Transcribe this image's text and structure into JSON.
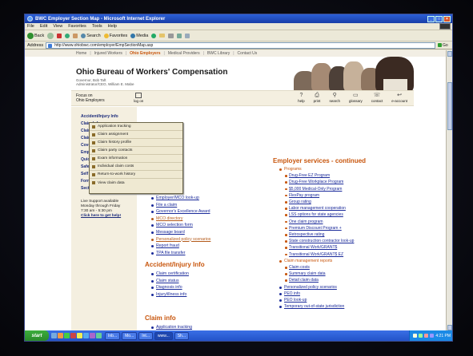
{
  "window": {
    "title": "BWC Employer Section Map - Microsoft Internet Explorer",
    "controls": [
      "_",
      "□",
      "×"
    ]
  },
  "menubar": [
    "File",
    "Edit",
    "View",
    "Favorites",
    "Tools",
    "Help"
  ],
  "toolbar": {
    "back": "Back",
    "search": "Search",
    "favorites": "Favorites",
    "media": "Media"
  },
  "addressbar": {
    "label": "Address",
    "url": "http://www.ohiobwc.com/employer/EmpSectionMap.asp",
    "go": "Go"
  },
  "topnav": [
    "Home",
    "Injured Workers",
    "Ohio Employers",
    "Medical Providers",
    "BWC Library",
    "Contact Us"
  ],
  "banner": {
    "title": "Ohio Bureau of Workers' Compensation",
    "governor": "Governor, Bob Taft",
    "administrator": "Administrator/CEO, William E. Mabe"
  },
  "iconbar": {
    "focus_line1": "Focus on",
    "focus_line2": "Ohio Employers",
    "login": "log on",
    "tools": [
      {
        "label": "help",
        "icon": "?"
      },
      {
        "label": "print",
        "icon": "⎙"
      },
      {
        "label": "search",
        "icon": "⚲"
      },
      {
        "label": "glossary",
        "icon": "▭"
      },
      {
        "label": "contact",
        "icon": "☏"
      },
      {
        "label": "e-account",
        "icon": "↩"
      }
    ]
  },
  "sidebar": {
    "items": [
      "Accident/Injury Info",
      "Claim Info",
      "Claim Payme",
      "Claim Referr",
      "Coverage Inf",
      "Employer Se",
      "Quick Pay",
      "Safety Servi",
      "Self Insured",
      "Forms",
      "Section Map"
    ],
    "support": [
      "Live Support available",
      "Monday through Friday",
      "7:30 am - 5:30 pm"
    ],
    "support_link": "Click here to get help!"
  },
  "popup": [
    "Application tracking",
    "Claim assignment",
    "Claim history profile",
    "Claim party contacts",
    "Exam information",
    "Individual claim costs",
    "Return-to-work history",
    "View claim data"
  ],
  "left_list": [
    "Employer/MCO look-up",
    "File a claim",
    "Governor's Excellence Award",
    "MCO directory",
    "MCO selection form",
    "Message board",
    "Personalized policy scenarios",
    "Report fraud",
    "TPA file transfer"
  ],
  "accident": {
    "heading": "Accident/Injury Info",
    "items": [
      "Claim certification",
      "Claim status",
      "Diagnosis info",
      "Injury/illness info"
    ]
  },
  "claiminfo": {
    "heading": "Claim info",
    "items": [
      "Application tracking"
    ]
  },
  "employer_services": {
    "heading": "Employer services - continued",
    "programs_label": "Programs",
    "programs": [
      "Drug-Free EZ Program",
      "Drug-Free Workplace Program",
      "$5,000 Medical-Only Program",
      "FlexPay program",
      "Group rating",
      "Labor management cooperation",
      "LSS options for state agencies",
      "One claim program",
      "Premium Discount Program +",
      "Retrospective rating",
      "State construction contractor look-up",
      "Transitional Work/GRANT$",
      "Transitional Work/GRANT$ EZ"
    ],
    "claim_reports_label": "Claim management reports",
    "claim_reports": [
      "Claim costs",
      "Summary claim data",
      "Detail claim data"
    ],
    "more": [
      "Personalized policy scenarios",
      "PEO info",
      "PEO look-up",
      "Temporary out-of-state jurisdiction"
    ]
  },
  "taskbar": {
    "start": "start",
    "tasks": [
      "Inb...",
      "Mo...",
      "Int...",
      "www...",
      "Sh..."
    ],
    "clock": "4:21 PM"
  },
  "colors": {
    "accent": "#c8560d",
    "link": "#1a2a9a",
    "title_blue": "#2353c8"
  }
}
